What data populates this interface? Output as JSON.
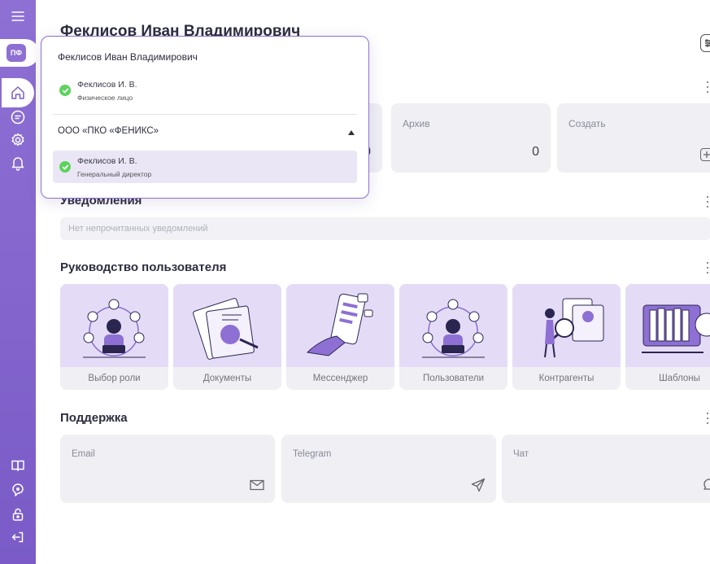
{
  "page": {
    "title": "Феклисов Иван Владимирович"
  },
  "profile_avatar": {
    "initials": "ПФ"
  },
  "profile_menu": {
    "title": "Феклисов Иван Владимирович",
    "personal": {
      "name": "Феклисов И. В.",
      "role": "Физическое лицо"
    },
    "organization": {
      "name": "ООО «ПКО «ФЕНИКС»",
      "expanded": true,
      "member": {
        "name": "Феклисов И. В.",
        "role": "Генеральный директор"
      }
    }
  },
  "documents": {
    "counter_partial": "0",
    "archive": {
      "label": "Архив",
      "count": "0"
    },
    "create": {
      "label": "Создать"
    }
  },
  "notifications": {
    "title": "Уведомления",
    "empty_text": "Нет непрочитанных уведомлений"
  },
  "guide": {
    "title": "Руководство пользователя",
    "cards": [
      {
        "label": "Выбор роли",
        "icon": "role-illustration"
      },
      {
        "label": "Документы",
        "icon": "documents-illustration"
      },
      {
        "label": "Мессенджер",
        "icon": "messenger-illustration"
      },
      {
        "label": "Пользователи",
        "icon": "users-illustration"
      },
      {
        "label": "Контрагенты",
        "icon": "counterparties-illustration"
      },
      {
        "label": "Шаблоны",
        "icon": "templates-illustration"
      }
    ]
  },
  "support": {
    "title": "Поддержка",
    "cards": [
      {
        "label": "Email",
        "icon": "envelope-icon"
      },
      {
        "label": "Telegram",
        "icon": "paper-plane-icon"
      },
      {
        "label": "Чат",
        "icon": "chat-icon"
      }
    ]
  },
  "colors": {
    "accent": "#8e70d4",
    "card_bg": "#efeff4",
    "success": "#5dd35d"
  }
}
